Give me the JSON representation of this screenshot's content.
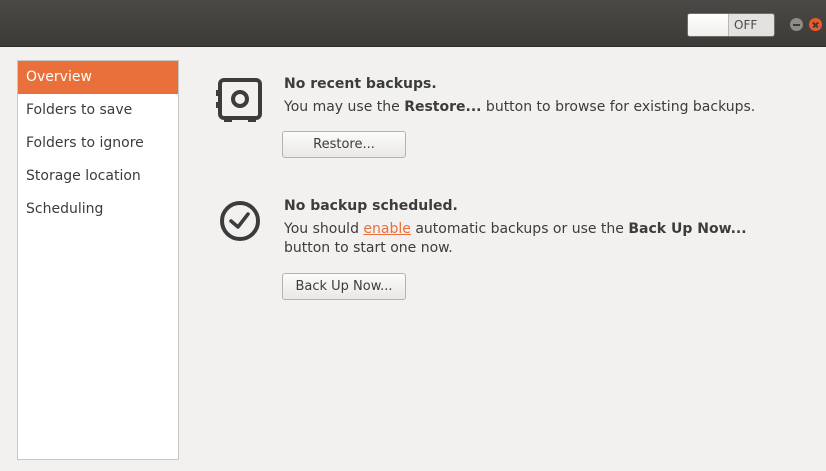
{
  "titlebar": {
    "switch_label": "OFF"
  },
  "sidebar": {
    "items": [
      {
        "label": "Overview"
      },
      {
        "label": "Folders to save"
      },
      {
        "label": "Folders to ignore"
      },
      {
        "label": "Storage location"
      },
      {
        "label": "Scheduling"
      }
    ]
  },
  "backups": {
    "title": "No recent backups.",
    "desc_prefix": "You may use the ",
    "desc_bold": "Restore...",
    "desc_suffix": " button to browse for existing backups.",
    "button": "Restore...",
    "icon": "safe-icon"
  },
  "schedule": {
    "title": "No backup scheduled.",
    "desc_prefix": "You should ",
    "desc_link": "enable",
    "desc_middle": " automatic backups or use the ",
    "desc_bold": "Back Up Now...",
    "desc_line2": "button to start one now.",
    "button": "Back Up Now...",
    "icon": "clock-icon"
  },
  "colors": {
    "accent": "#e9703a",
    "titlebar": "#3c3b37",
    "close": "#ea5a2b"
  }
}
